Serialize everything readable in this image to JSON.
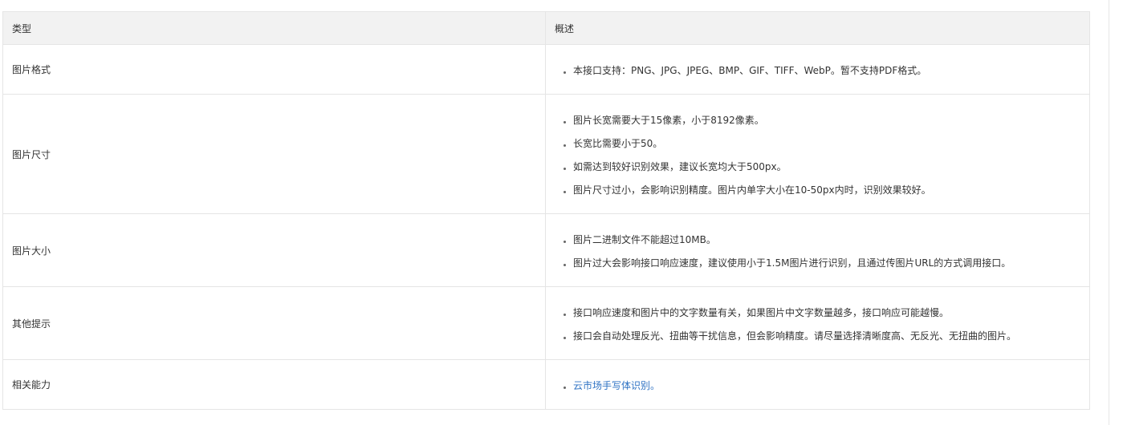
{
  "table": {
    "headers": {
      "type": "类型",
      "desc": "概述"
    },
    "rows": [
      {
        "type": "图片格式",
        "items": [
          "本接口支持：PNG、JPG、JPEG、BMP、GIF、TIFF、WebP。暂不支持PDF格式。"
        ]
      },
      {
        "type": "图片尺寸",
        "items": [
          "图片长宽需要大于15像素，小于8192像素。",
          "长宽比需要小于50。",
          "如需达到较好识别效果，建议长宽均大于500px。",
          "图片尺寸过小，会影响识别精度。图片内单字大小在10-50px内时，识别效果较好。"
        ]
      },
      {
        "type": "图片大小",
        "items": [
          "图片二进制文件不能超过10MB。",
          "图片过大会影响接口响应速度，建议使用小于1.5M图片进行识别，且通过传图片URL的方式调用接口。"
        ]
      },
      {
        "type": "其他提示",
        "items": [
          "接口响应速度和图片中的文字数量有关，如果图片中文字数量越多，接口响应可能越慢。",
          "接口会自动处理反光、扭曲等干扰信息，但会影响精度。请尽量选择清晰度高、无反光、无扭曲的图片。"
        ]
      },
      {
        "type": "相关能力",
        "link": "云市场手写体识别。"
      }
    ]
  }
}
